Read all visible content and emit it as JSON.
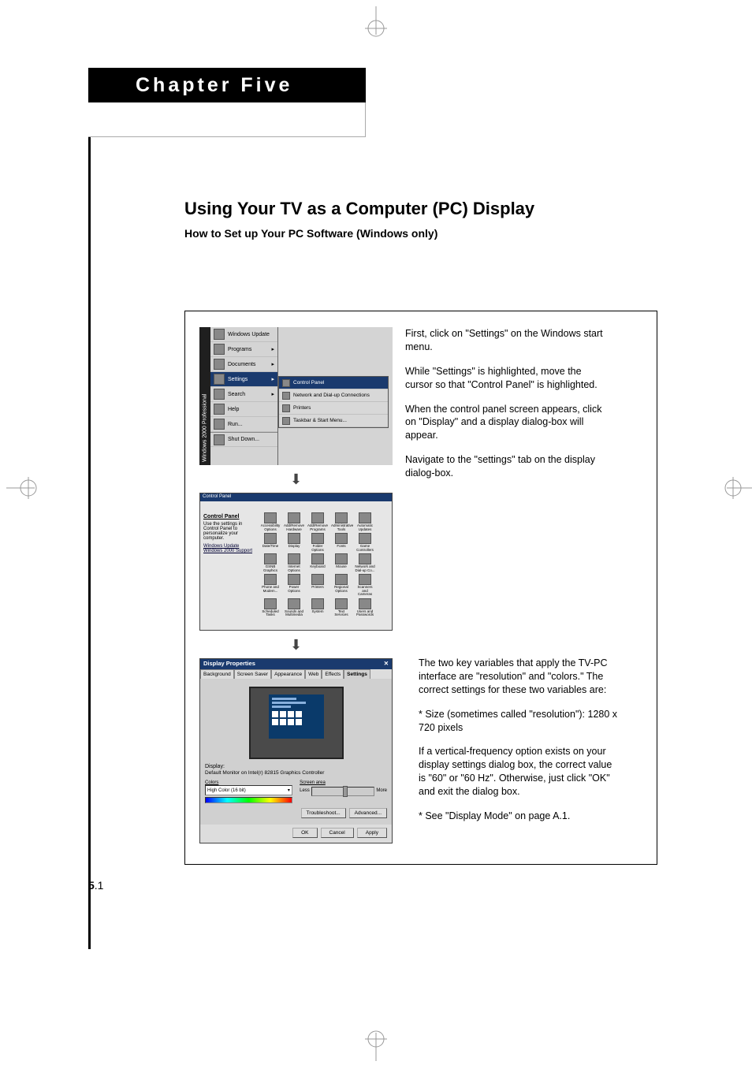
{
  "chapter": {
    "label": "Chapter Five"
  },
  "headings": {
    "title": "Using Your TV as a Computer (PC) Display",
    "subtitle": "How to Set up Your PC Software (Windows only)"
  },
  "text_block_1": {
    "p1": "First, click on \"Settings\" on the Windows start menu.",
    "p2": "While \"Settings\" is highlighted, move the cursor so that \"Control Panel\" is highlighted.",
    "p3": "When the control panel screen appears, click on \"Display\" and a display dialog-box will appear.",
    "p4": "Navigate to the \"settings\" tab on the display dialog-box."
  },
  "text_block_2": {
    "p1": "The two key variables that apply the TV-PC interface are \"resolution\" and \"colors.\" The correct settings for these two variables are:",
    "p2": "* Size (sometimes called \"resolution\"): 1280 x 720 pixels",
    "p3": "If a vertical-frequency option exists on your display settings dialog box, the correct value is \"60\" or \"60 Hz\". Otherwise, just click \"OK\" and exit the dialog box.",
    "p4": "* See \"Display Mode\" on page A.1."
  },
  "start_menu": {
    "brand": "Windows 2000 Professional",
    "items": [
      "Windows Update",
      "Programs",
      "Documents",
      "Settings",
      "Search",
      "Help",
      "Run...",
      "Shut Down..."
    ],
    "submenu": [
      "Control Panel",
      "Network and Dial-up Connections",
      "Printers",
      "Taskbar & Start Menu..."
    ]
  },
  "control_panel": {
    "title": "Control Panel",
    "side_heading": "Control Panel",
    "side_text": "Use the settings in Control Panel to personalize your computer.",
    "links": [
      "Windows Update",
      "Windows 2000 Support"
    ],
    "icons": [
      "Accessibility Options",
      "Add/Remove Hardware",
      "Add/Remove Programs",
      "Administrative Tools",
      "Automatic Updates",
      "Date/Time",
      "Display",
      "Folder Options",
      "Fonts",
      "Game Controllers",
      "GSNB Graphics",
      "Internet Options",
      "Keyboard",
      "Mouse",
      "Network and Dial-up Co...",
      "Phone and Modem...",
      "Power Options",
      "Printers",
      "Regional Options",
      "Scanners and Cameras",
      "Scheduled Tasks",
      "Sounds and Multimedia",
      "System",
      "Text Services",
      "Users and Passwords"
    ]
  },
  "display_props": {
    "title": "Display Properties",
    "tabs": [
      "Background",
      "Screen Saver",
      "Appearance",
      "Web",
      "Effects",
      "Settings"
    ],
    "display_label": "Display:",
    "display_value": "Default Monitor on Intel(r) 82815 Graphics Controller",
    "colors_label": "Colors",
    "colors_value": "High Color (16 bit)",
    "area_label": "Screen area",
    "area_less": "Less",
    "area_more": "More",
    "troubleshoot": "Troubleshoot...",
    "advanced": "Advanced...",
    "ok": "OK",
    "cancel": "Cancel",
    "apply": "Apply"
  },
  "page_number": {
    "major": "5",
    "minor": ".1"
  }
}
